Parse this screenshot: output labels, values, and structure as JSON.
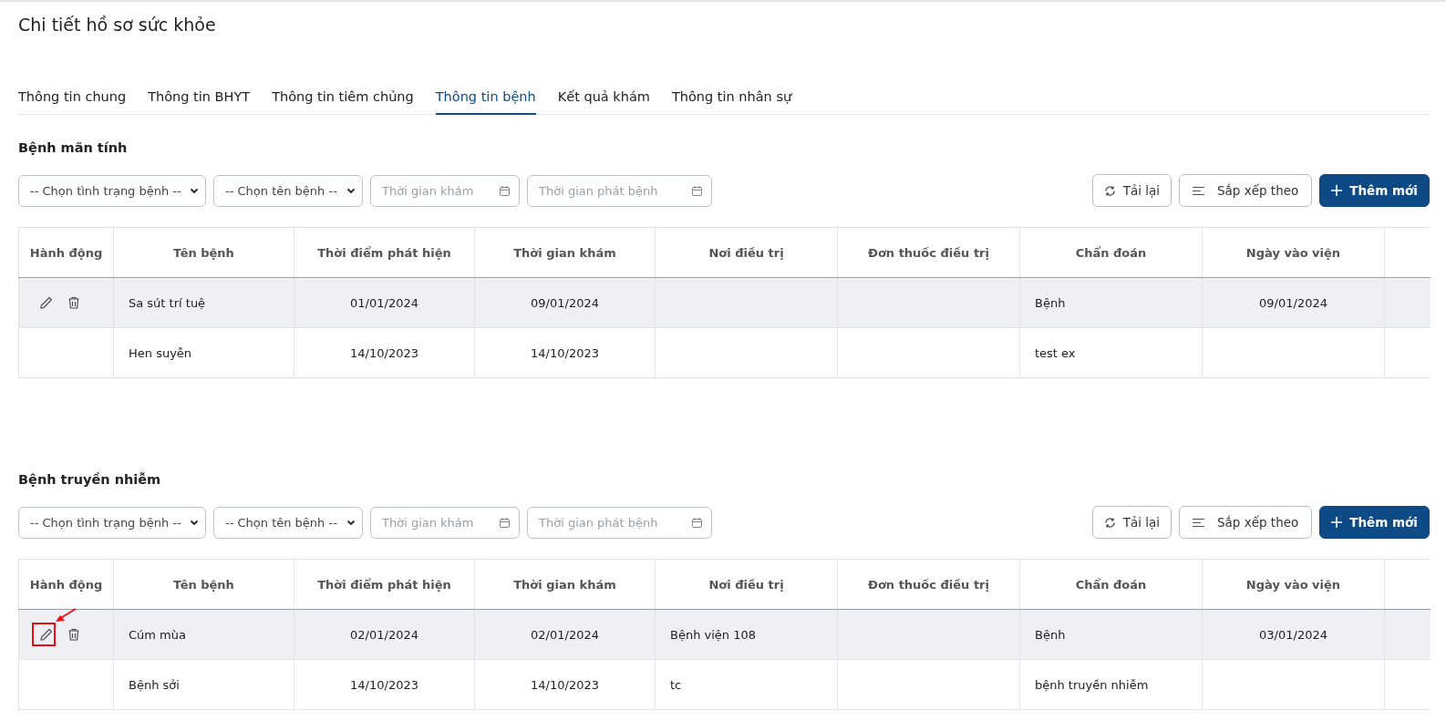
{
  "page_title": "Chi tiết hồ sơ sức khỏe",
  "tabs": [
    {
      "label": "Thông tin chung",
      "selected": false
    },
    {
      "label": "Thông tin BHYT",
      "selected": false
    },
    {
      "label": "Thông tin tiêm chủng",
      "selected": false
    },
    {
      "label": "Thông tin bệnh",
      "selected": true
    },
    {
      "label": "Kết quả khám",
      "selected": false
    },
    {
      "label": "Thông tin nhân sự",
      "selected": false
    }
  ],
  "sections": [
    {
      "heading": "Bệnh mãn tính",
      "filters": {
        "status_select": "-- Chọn tình trạng bệnh --",
        "name_select": "-- Chọn tên bệnh --",
        "exam_date_placeholder": "Thời gian khám",
        "onset_date_placeholder": "Thời gian phát bệnh"
      },
      "buttons": {
        "reload": "Tải lại",
        "sort": "Sắp xếp theo",
        "add": "Thêm mới"
      },
      "columns": [
        "Hành động",
        "Tên bệnh",
        "Thời điểm phát hiện",
        "Thời gian khám",
        "Nơi điều trị",
        "Đơn thuốc điều trị",
        "Chẩn đoán",
        "Ngày vào viện"
      ],
      "rows": [
        {
          "highlighted": true,
          "actions": true,
          "annotated": false,
          "cells": [
            "",
            "Sa sút trí tuệ",
            "01/01/2024",
            "09/01/2024",
            "",
            "",
            "Bệnh",
            "09/01/2024"
          ]
        },
        {
          "highlighted": false,
          "actions": false,
          "annotated": false,
          "cells": [
            "",
            "Hen suyễn",
            "14/10/2023",
            "14/10/2023",
            "",
            "",
            "test ex",
            ""
          ]
        }
      ]
    },
    {
      "heading": "Bệnh truyền nhiễm",
      "filters": {
        "status_select": "-- Chọn tình trạng bệnh --",
        "name_select": "-- Chọn tên bệnh --",
        "exam_date_placeholder": "Thời gian khám",
        "onset_date_placeholder": "Thời gian phát bệnh"
      },
      "buttons": {
        "reload": "Tải lại",
        "sort": "Sắp xếp theo",
        "add": "Thêm mới"
      },
      "columns": [
        "Hành động",
        "Tên bệnh",
        "Thời điểm phát hiện",
        "Thời gian khám",
        "Nơi điều trị",
        "Đơn thuốc điều trị",
        "Chẩn đoán",
        "Ngày vào viện"
      ],
      "rows": [
        {
          "highlighted": true,
          "actions": true,
          "annotated": true,
          "cells": [
            "",
            "Cúm mùa",
            "02/01/2024",
            "02/01/2024",
            "Bệnh viện 108",
            "",
            "Bệnh",
            "03/01/2024"
          ]
        },
        {
          "highlighted": false,
          "actions": false,
          "annotated": false,
          "cells": [
            "",
            "Bệnh sởi",
            "14/10/2023",
            "14/10/2023",
            "tc",
            "",
            "bệnh truyền nhiễm",
            ""
          ]
        }
      ]
    }
  ]
}
